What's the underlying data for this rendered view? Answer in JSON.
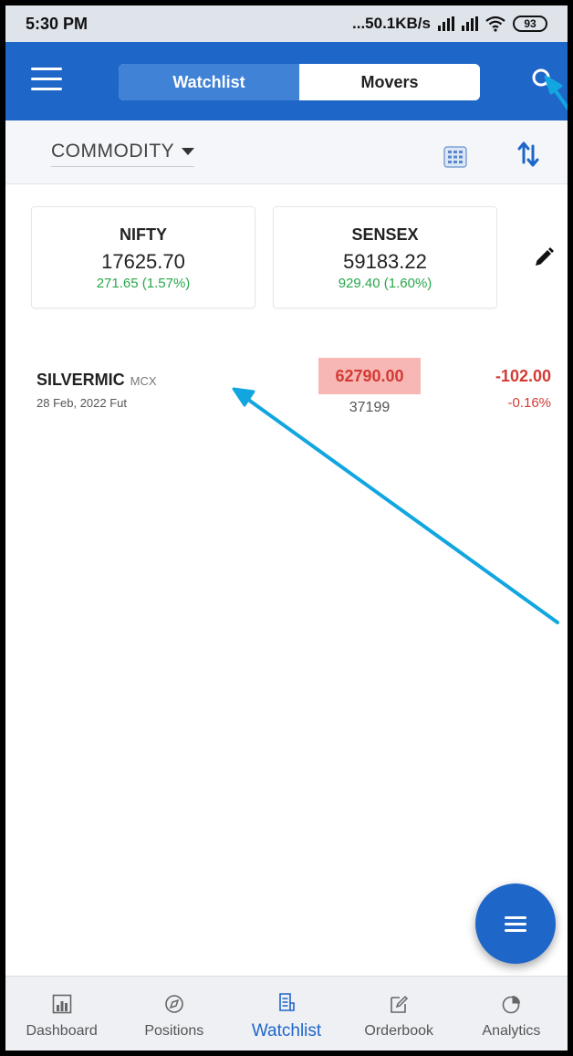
{
  "status_bar": {
    "time": "5:30 PM",
    "network_speed": "...50.1KB/s",
    "battery": "93"
  },
  "app_bar": {
    "tabs": [
      {
        "label": "Watchlist",
        "active": true
      },
      {
        "label": "Movers",
        "active": false
      }
    ],
    "menu_icon": "hamburger-menu-icon",
    "search_icon": "search-icon"
  },
  "filter": {
    "segment": "COMMODITY",
    "grid_icon": "grid-view-icon",
    "sort_icon": "sort-icon"
  },
  "indices": [
    {
      "name": "NIFTY",
      "value": "17625.70",
      "change": "271.65 (1.57%)"
    },
    {
      "name": "SENSEX",
      "value": "59183.22",
      "change": "929.40 (1.60%)"
    }
  ],
  "watchlist": [
    {
      "symbol": "SILVERMIC",
      "exchange": "MCX",
      "expiry": "28 Feb, 2022 Fut",
      "ltp": "62790.00",
      "volume": "37199",
      "change": "-102.00",
      "change_pct": "-0.16%"
    }
  ],
  "bottom_nav": [
    {
      "label": "Dashboard",
      "icon": "dashboard-icon",
      "active": false
    },
    {
      "label": "Positions",
      "icon": "compass-icon",
      "active": false
    },
    {
      "label": "Watchlist",
      "icon": "list-icon",
      "active": true
    },
    {
      "label": "Orderbook",
      "icon": "edit-note-icon",
      "active": false
    },
    {
      "label": "Analytics",
      "icon": "pie-chart-icon",
      "active": false
    }
  ],
  "colors": {
    "primary": "#1f66c9",
    "positive": "#27a84a",
    "negative": "#d23b33",
    "annotation_arrow": "#12a6e0"
  }
}
